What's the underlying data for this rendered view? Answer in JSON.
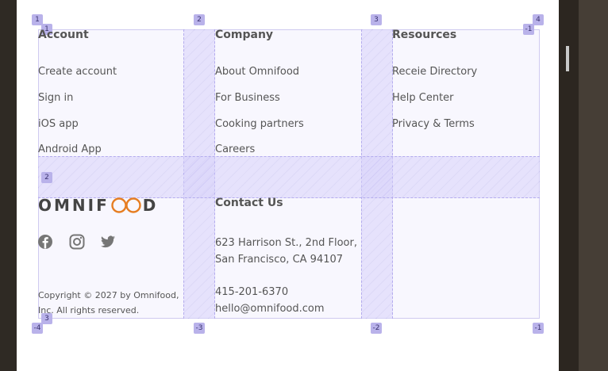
{
  "columns": {
    "account": {
      "heading": "Account",
      "links": [
        "Create account",
        "Sign in",
        "iOS app",
        "Android App"
      ]
    },
    "company": {
      "heading": "Company",
      "links": [
        "About Omnifood",
        "For Business",
        "Cooking partners",
        "Careers"
      ]
    },
    "resources": {
      "heading": "Resources",
      "links": [
        "Receie Directory",
        "Help Center",
        "Privacy & Terms"
      ]
    }
  },
  "brand": {
    "logo_prefix": "OMNIF",
    "logo_suffix": "D",
    "logo_accent": "#e67e22",
    "copyright_line1": "Copyright © 2027 by Omnifood,",
    "copyright_line2": "Inc. All rights reserved."
  },
  "social": {
    "icons": [
      "facebook-icon",
      "instagram-icon",
      "twitter-icon"
    ],
    "color": "#767676"
  },
  "contact": {
    "heading": "Contact Us",
    "address_line1": "623 Harrison St., 2nd Floor,",
    "address_line2": "San Francisco, CA 94107",
    "phone": "415-201-6370",
    "email": "hello@omnifood.com"
  },
  "grid_overlay": {
    "column_labels_top": [
      "1",
      "2",
      "3",
      "4"
    ],
    "column_labels_bottom": [
      "-4",
      "-3",
      "-2",
      "-1"
    ],
    "row_labels": [
      "1",
      "2",
      "3"
    ],
    "row_end_label": "-1",
    "color": "#b9b2ea"
  }
}
